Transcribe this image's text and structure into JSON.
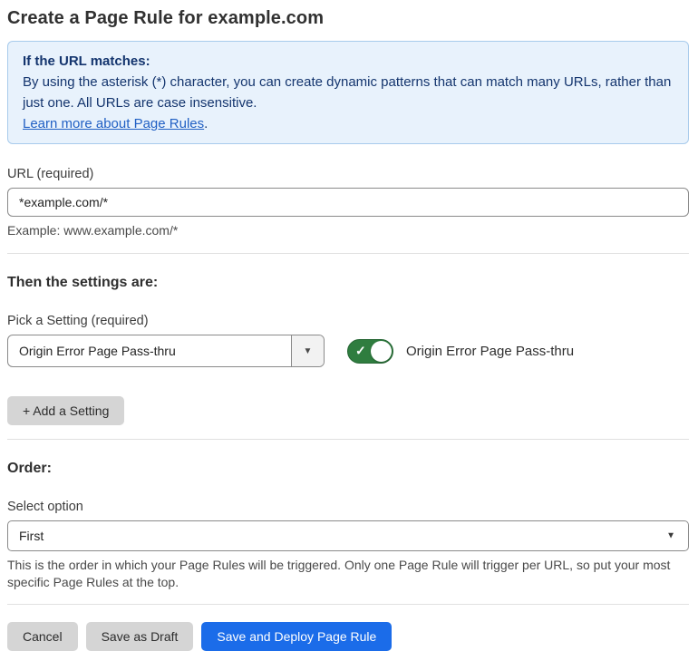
{
  "page": {
    "title": "Create a Page Rule for example.com"
  },
  "info_box": {
    "heading": "If the URL matches:",
    "body": "By using the asterisk (*) character, you can create dynamic patterns that can match many URLs, rather than just one. All URLs are case insensitive.",
    "link_text": "Learn more about Page Rules",
    "link_suffix": "."
  },
  "url_field": {
    "label": "URL (required)",
    "value": "*example.com/*",
    "helper": "Example: www.example.com/*"
  },
  "settings_section": {
    "heading": "Then the settings are:",
    "picker_label": "Pick a Setting (required)",
    "picker_value": "Origin Error Page Pass-thru",
    "toggle_state": "on",
    "toggle_label": "Origin Error Page Pass-thru",
    "add_setting_label": "+ Add a Setting"
  },
  "order_section": {
    "heading": "Order:",
    "select_label": "Select option",
    "select_value": "First",
    "helper": "This is the order in which your Page Rules will be triggered. Only one Page Rule will trigger per URL, so put your most specific Page Rules at the top."
  },
  "footer": {
    "cancel_label": "Cancel",
    "save_draft_label": "Save as Draft",
    "save_deploy_label": "Save and Deploy Page Rule"
  },
  "icons": {
    "caret_down": "▼",
    "check": "✓"
  },
  "colors": {
    "info_bg": "#e8f2fc",
    "info_border": "#a8cbec",
    "info_text": "#14356e",
    "link": "#2160c4",
    "toggle_on": "#2f7d3f",
    "primary_button": "#1b6ce9",
    "gray_button": "#d5d5d5",
    "input_border": "#8a8a8a"
  }
}
